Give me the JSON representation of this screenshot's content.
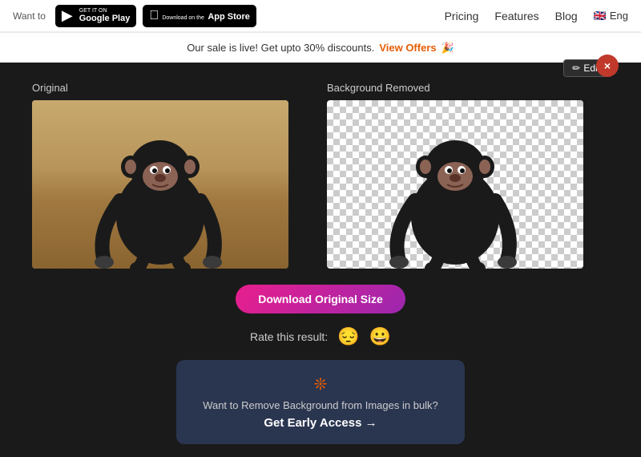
{
  "nav": {
    "want_text": "Want to",
    "google_play": {
      "line1": "GET IT ON",
      "line2": "Google Play"
    },
    "app_store": {
      "line1": "Download on the",
      "line2": "App Store"
    },
    "links": [
      {
        "label": "Pricing",
        "id": "pricing"
      },
      {
        "label": "Features",
        "id": "features"
      },
      {
        "label": "Blog",
        "id": "blog"
      }
    ],
    "lang": "Eng"
  },
  "sale_banner": {
    "text": "Our sale is live! Get upto 30% discounts.",
    "link_text": "View Offers",
    "emoji": "🎉"
  },
  "close_button": "×",
  "panels": {
    "original_label": "Original",
    "removed_label": "Background Removed",
    "edit_button": "✏ Edit"
  },
  "download": {
    "button_label": "Download Original Size"
  },
  "rating": {
    "label": "Rate this result:",
    "sad_emoji": "😔",
    "happy_emoji": "😀"
  },
  "bulk": {
    "icon": "❊",
    "title": "Want to Remove Background from Images in bulk?",
    "cta": "Get Early Access →"
  }
}
